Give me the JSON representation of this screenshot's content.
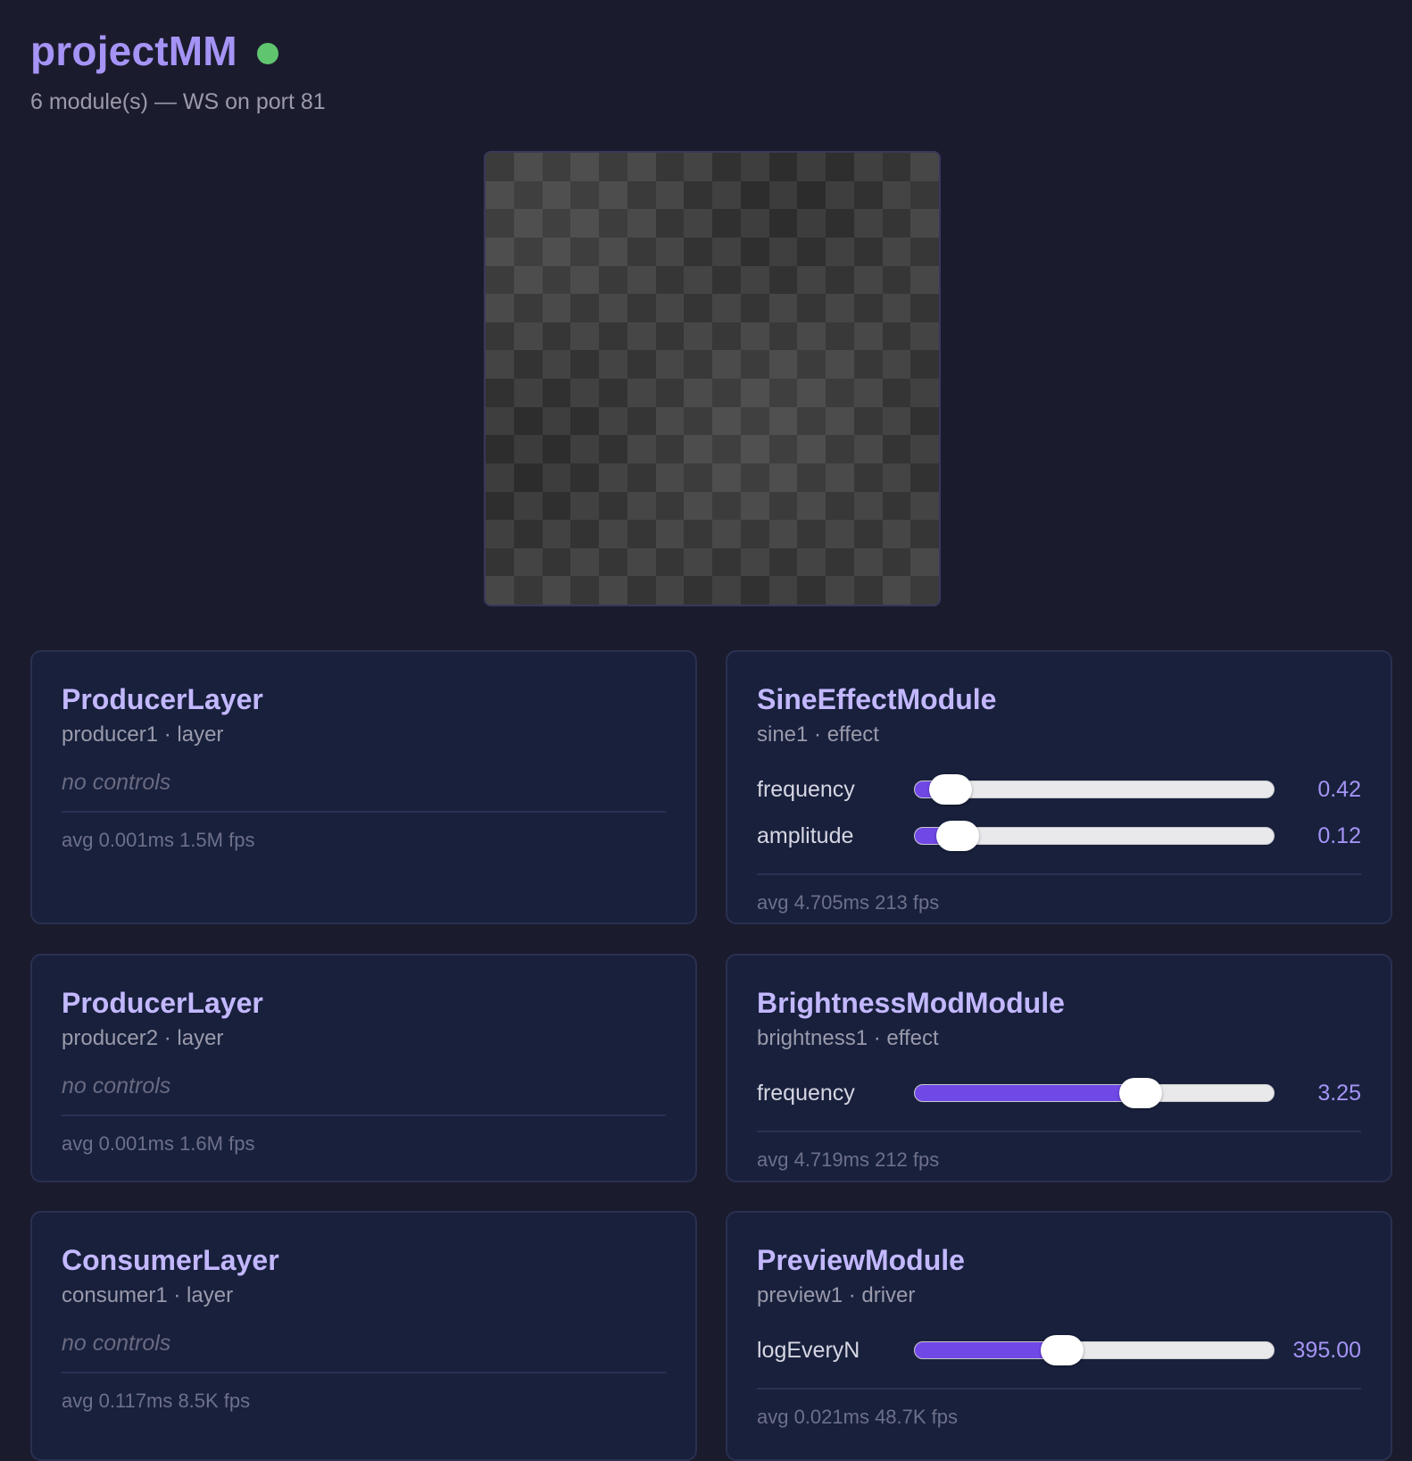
{
  "header": {
    "title": "projectMM",
    "subtitle": "6 module(s) — WS on port 81",
    "status_color": "#5fc56e"
  },
  "modules": [
    {
      "name": "ProducerLayer",
      "meta": "producer1 · layer",
      "no_controls": "no controls",
      "stats": "avg 0.001ms 1.5M fps"
    },
    {
      "name": "SineEffectModule",
      "meta": "sine1 · effect",
      "controls": [
        {
          "label": "frequency",
          "value": "0.42",
          "level": 0.1
        },
        {
          "label": "amplitude",
          "value": "0.12",
          "level": 0.12
        }
      ],
      "stats": "avg 4.705ms 213 fps"
    },
    {
      "name": "ProducerLayer",
      "meta": "producer2 · layer",
      "no_controls": "no controls",
      "stats": "avg 0.001ms 1.6M fps"
    },
    {
      "name": "BrightnessModModule",
      "meta": "brightness1 · effect",
      "controls": [
        {
          "label": "frequency",
          "value": "3.25",
          "level": 0.63
        }
      ],
      "stats": "avg 4.719ms 212 fps"
    },
    {
      "name": "ConsumerLayer",
      "meta": "consumer1 · layer",
      "no_controls": "no controls",
      "stats": "avg 0.117ms 8.5K fps"
    },
    {
      "name": "PreviewModule",
      "meta": "preview1 · driver",
      "controls": [
        {
          "label": "logEveryN",
          "value": "395.00",
          "level": 0.41
        }
      ],
      "stats": "avg 0.021ms 48.7K fps"
    }
  ]
}
